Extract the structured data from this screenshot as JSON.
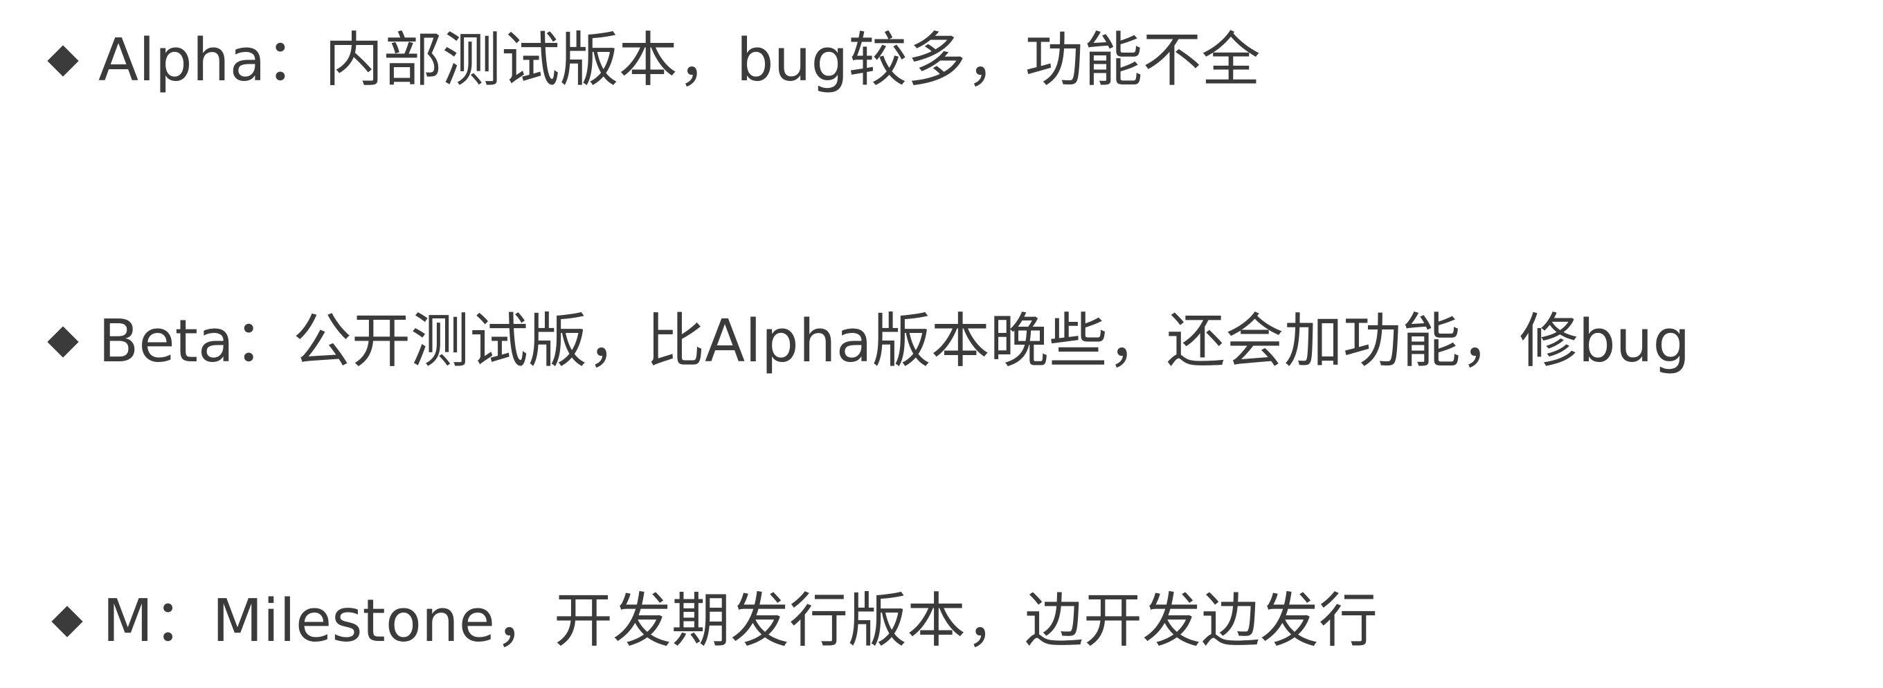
{
  "bullets": [
    {
      "icon": "diamond-bullet",
      "text": "Alpha：内部测试版本，bug较多，功能不全"
    },
    {
      "icon": "diamond-bullet",
      "text": "Beta：公开测试版，比Alpha版本晚些，还会加功能，修bug"
    },
    {
      "icon": "diamond-bullet",
      "text": "M：Milestone，开发期发行版本，边开发边发行"
    }
  ],
  "colors": {
    "text": "#3b3b3b",
    "background": "#ffffff"
  }
}
